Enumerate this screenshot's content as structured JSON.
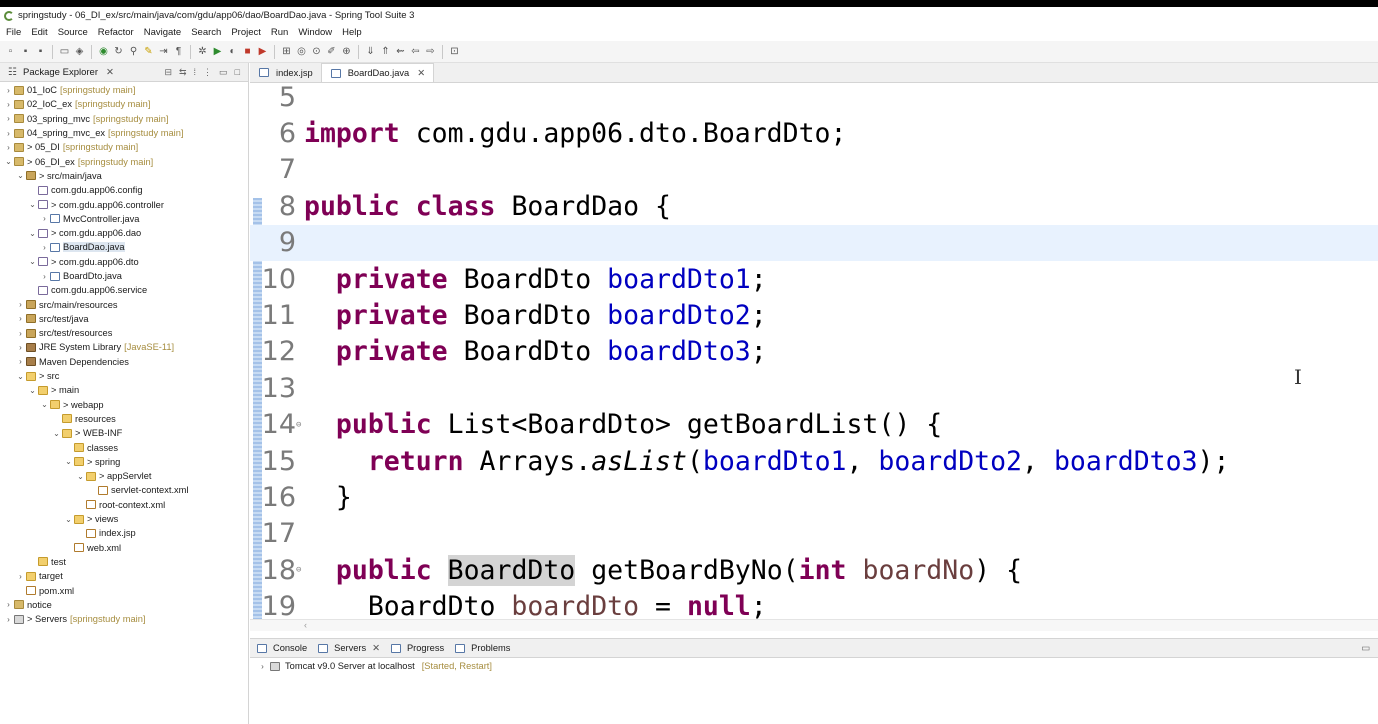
{
  "window": {
    "title": "springstudy - 06_DI_ex/src/main/java/com/gdu/app06/dao/BoardDao.java - Spring Tool Suite 3"
  },
  "menu": [
    "File",
    "Edit",
    "Source",
    "Refactor",
    "Navigate",
    "Search",
    "Project",
    "Run",
    "Window",
    "Help"
  ],
  "package_explorer": {
    "title": "Package Explorer",
    "tree": [
      {
        "indent": 0,
        "twisty": "›",
        "icon": "proj",
        "label": "01_IoC",
        "suffix": "[springstudy main]"
      },
      {
        "indent": 0,
        "twisty": "›",
        "icon": "proj",
        "label": "02_IoC_ex",
        "suffix": "[springstudy main]"
      },
      {
        "indent": 0,
        "twisty": "›",
        "icon": "proj",
        "label": "03_spring_mvc",
        "suffix": "[springstudy main]"
      },
      {
        "indent": 0,
        "twisty": "›",
        "icon": "proj",
        "label": "04_spring_mvc_ex",
        "suffix": "[springstudy main]"
      },
      {
        "indent": 0,
        "twisty": "›",
        "icon": "proj",
        "label": "> 05_DI",
        "suffix": "[springstudy main]"
      },
      {
        "indent": 0,
        "twisty": "⌄",
        "icon": "proj",
        "label": "> 06_DI_ex",
        "suffix": "[springstudy main]"
      },
      {
        "indent": 1,
        "twisty": "⌄",
        "icon": "src",
        "label": "> src/main/java",
        "suffix": ""
      },
      {
        "indent": 2,
        "twisty": "",
        "icon": "pkg",
        "label": "com.gdu.app06.config",
        "suffix": ""
      },
      {
        "indent": 2,
        "twisty": "⌄",
        "icon": "pkg",
        "label": "> com.gdu.app06.controller",
        "suffix": ""
      },
      {
        "indent": 3,
        "twisty": "›",
        "icon": "jfile",
        "label": "MvcController.java",
        "suffix": ""
      },
      {
        "indent": 2,
        "twisty": "⌄",
        "icon": "pkg",
        "label": "> com.gdu.app06.dao",
        "suffix": ""
      },
      {
        "indent": 3,
        "twisty": "›",
        "icon": "jfile",
        "label": "BoardDao.java",
        "suffix": "",
        "selected": true
      },
      {
        "indent": 2,
        "twisty": "⌄",
        "icon": "pkg",
        "label": "> com.gdu.app06.dto",
        "suffix": ""
      },
      {
        "indent": 3,
        "twisty": "›",
        "icon": "jfile",
        "label": "BoardDto.java",
        "suffix": ""
      },
      {
        "indent": 2,
        "twisty": "",
        "icon": "pkg",
        "label": "com.gdu.app06.service",
        "suffix": ""
      },
      {
        "indent": 1,
        "twisty": "›",
        "icon": "src",
        "label": "src/main/resources",
        "suffix": ""
      },
      {
        "indent": 1,
        "twisty": "›",
        "icon": "src",
        "label": "src/test/java",
        "suffix": ""
      },
      {
        "indent": 1,
        "twisty": "›",
        "icon": "src",
        "label": "src/test/resources",
        "suffix": ""
      },
      {
        "indent": 1,
        "twisty": "›",
        "icon": "lib",
        "label": "JRE System Library",
        "suffix": "[JavaSE-11]"
      },
      {
        "indent": 1,
        "twisty": "›",
        "icon": "lib",
        "label": "Maven Dependencies",
        "suffix": ""
      },
      {
        "indent": 1,
        "twisty": "⌄",
        "icon": "folder",
        "label": "> src",
        "suffix": ""
      },
      {
        "indent": 2,
        "twisty": "⌄",
        "icon": "folder",
        "label": "> main",
        "suffix": ""
      },
      {
        "indent": 3,
        "twisty": "⌄",
        "icon": "folder",
        "label": "> webapp",
        "suffix": ""
      },
      {
        "indent": 4,
        "twisty": "",
        "icon": "folder",
        "label": "resources",
        "suffix": ""
      },
      {
        "indent": 4,
        "twisty": "⌄",
        "icon": "folder",
        "label": "> WEB-INF",
        "suffix": ""
      },
      {
        "indent": 5,
        "twisty": "",
        "icon": "folder",
        "label": "classes",
        "suffix": ""
      },
      {
        "indent": 5,
        "twisty": "⌄",
        "icon": "folder",
        "label": "> spring",
        "suffix": ""
      },
      {
        "indent": 6,
        "twisty": "⌄",
        "icon": "folder",
        "label": "> appServlet",
        "suffix": ""
      },
      {
        "indent": 7,
        "twisty": "",
        "icon": "xml",
        "label": "servlet-context.xml",
        "suffix": ""
      },
      {
        "indent": 6,
        "twisty": "",
        "icon": "xml",
        "label": "root-context.xml",
        "suffix": ""
      },
      {
        "indent": 5,
        "twisty": "⌄",
        "icon": "folder",
        "label": "> views",
        "suffix": ""
      },
      {
        "indent": 6,
        "twisty": "",
        "icon": "xml",
        "label": "index.jsp",
        "suffix": ""
      },
      {
        "indent": 5,
        "twisty": "",
        "icon": "xml",
        "label": "web.xml",
        "suffix": ""
      },
      {
        "indent": 2,
        "twisty": "",
        "icon": "folder",
        "label": "test",
        "suffix": ""
      },
      {
        "indent": 1,
        "twisty": "›",
        "icon": "folder",
        "label": "target",
        "suffix": ""
      },
      {
        "indent": 1,
        "twisty": "",
        "icon": "xml",
        "label": "pom.xml",
        "suffix": ""
      },
      {
        "indent": 0,
        "twisty": "›",
        "icon": "proj",
        "label": "notice",
        "suffix": ""
      },
      {
        "indent": 0,
        "twisty": "›",
        "icon": "srv",
        "label": "> Servers",
        "suffix": "[springstudy main]"
      }
    ]
  },
  "editor": {
    "tabs": [
      {
        "label": "index.jsp",
        "active": false
      },
      {
        "label": "BoardDao.java",
        "active": true
      }
    ],
    "lines": [
      {
        "num": "5",
        "fold": "",
        "parts": []
      },
      {
        "num": "6",
        "fold": "",
        "parts": [
          {
            "t": "import",
            "c": "kw"
          },
          {
            "t": " com.gdu.app06.dto.BoardDto;",
            "c": ""
          }
        ]
      },
      {
        "num": "7",
        "fold": "",
        "parts": []
      },
      {
        "num": "8",
        "fold": "",
        "parts": [
          {
            "t": "public",
            "c": "kw"
          },
          {
            "t": " ",
            "c": ""
          },
          {
            "t": "class",
            "c": "kw"
          },
          {
            "t": " BoardDao {",
            "c": ""
          }
        ]
      },
      {
        "num": "9",
        "fold": "",
        "current": true,
        "parts": []
      },
      {
        "num": "10",
        "fold": "",
        "parts": [
          {
            "t": "  ",
            "c": ""
          },
          {
            "t": "private",
            "c": "kw"
          },
          {
            "t": " BoardDto ",
            "c": ""
          },
          {
            "t": "boardDto1",
            "c": "fld"
          },
          {
            "t": ";",
            "c": ""
          }
        ]
      },
      {
        "num": "11",
        "fold": "",
        "parts": [
          {
            "t": "  ",
            "c": ""
          },
          {
            "t": "private",
            "c": "kw"
          },
          {
            "t": " BoardDto ",
            "c": ""
          },
          {
            "t": "boardDto2",
            "c": "fld"
          },
          {
            "t": ";",
            "c": ""
          }
        ]
      },
      {
        "num": "12",
        "fold": "",
        "parts": [
          {
            "t": "  ",
            "c": ""
          },
          {
            "t": "private",
            "c": "kw"
          },
          {
            "t": " BoardDto ",
            "c": ""
          },
          {
            "t": "boardDto3",
            "c": "fld"
          },
          {
            "t": ";",
            "c": ""
          }
        ]
      },
      {
        "num": "13",
        "fold": "",
        "parts": []
      },
      {
        "num": "14",
        "fold": "⊖",
        "parts": [
          {
            "t": "  ",
            "c": ""
          },
          {
            "t": "public",
            "c": "kw"
          },
          {
            "t": " List<BoardDto> getBoardList() {",
            "c": ""
          }
        ]
      },
      {
        "num": "15",
        "fold": "",
        "parts": [
          {
            "t": "    ",
            "c": ""
          },
          {
            "t": "return",
            "c": "kw"
          },
          {
            "t": " Arrays.",
            "c": ""
          },
          {
            "t": "asList",
            "c": "it"
          },
          {
            "t": "(",
            "c": ""
          },
          {
            "t": "boardDto1",
            "c": "fld"
          },
          {
            "t": ", ",
            "c": ""
          },
          {
            "t": "boardDto2",
            "c": "fld"
          },
          {
            "t": ", ",
            "c": ""
          },
          {
            "t": "boardDto3",
            "c": "fld"
          },
          {
            "t": ");",
            "c": ""
          }
        ]
      },
      {
        "num": "16",
        "fold": "",
        "parts": [
          {
            "t": "  }",
            "c": ""
          }
        ]
      },
      {
        "num": "17",
        "fold": "",
        "parts": []
      },
      {
        "num": "18",
        "fold": "⊖",
        "parts": [
          {
            "t": "  ",
            "c": ""
          },
          {
            "t": "public",
            "c": "kw"
          },
          {
            "t": " ",
            "c": ""
          },
          {
            "t": "BoardDto",
            "c": "occ"
          },
          {
            "t": " getBoardByNo(",
            "c": ""
          },
          {
            "t": "int",
            "c": "kw"
          },
          {
            "t": " ",
            "c": ""
          },
          {
            "t": "boardNo",
            "c": "loc"
          },
          {
            "t": ") {",
            "c": ""
          }
        ]
      },
      {
        "num": "19",
        "fold": "",
        "parts": [
          {
            "t": "    BoardDto ",
            "c": ""
          },
          {
            "t": "boardDto",
            "c": "loc"
          },
          {
            "t": " = ",
            "c": ""
          },
          {
            "t": "null",
            "c": "kw"
          },
          {
            "t": ";",
            "c": ""
          }
        ]
      }
    ],
    "hscroll_mark": "‹"
  },
  "bottom_panel": {
    "tabs": [
      {
        "label": "Console",
        "icon": "console-icon"
      },
      {
        "label": "Servers",
        "icon": "servers-icon",
        "active": true
      },
      {
        "label": "Progress",
        "icon": "progress-icon"
      },
      {
        "label": "Problems",
        "icon": "problems-icon"
      }
    ],
    "server": {
      "name": "Tomcat v9.0 Server at localhost",
      "state": "[Started, Restart]"
    }
  },
  "colors": {
    "keyword": "#7f0055",
    "field": "#0000c0",
    "local": "#6a3e3e",
    "current_line": "#e8f2fe"
  }
}
